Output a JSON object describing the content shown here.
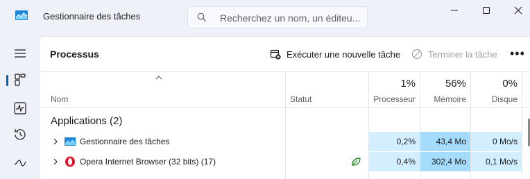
{
  "window": {
    "title": "Gestionnaire des tâches",
    "search_placeholder": "Recherchez un nom, un éditeu..."
  },
  "toolbar": {
    "page_title": "Processus",
    "run_new_task": "Exécuter une nouvelle tâche",
    "end_task": "Terminer la tâche",
    "more": "•••"
  },
  "table": {
    "columns": {
      "name": "Nom",
      "status": "Statut",
      "cpu_pct": "1%",
      "cpu_label": "Processeur",
      "mem_pct": "56%",
      "mem_label": "Mémoire",
      "disk_pct": "0%",
      "disk_label": "Disque"
    },
    "group": "Applications (2)",
    "rows": [
      {
        "name": "Gestionnaire des tâches",
        "icon": "task-manager-icon",
        "status": "",
        "cpu": "0,2%",
        "mem": "43,4 Mo",
        "disk": "0 Mo/s"
      },
      {
        "name": "Opera Internet Browser (32 bits) (17)",
        "icon": "opera-icon",
        "status": "efficiency-leaf-icon",
        "cpu": "0,4%",
        "mem": "302,4 Mo",
        "disk": "0,1 Mo/s"
      }
    ]
  },
  "colors": {
    "accent": "#005fb8",
    "heat_low": "#d3efff",
    "heat_mid": "#a6dcfb",
    "leaf": "#107c10",
    "opera": "#e0142d"
  }
}
